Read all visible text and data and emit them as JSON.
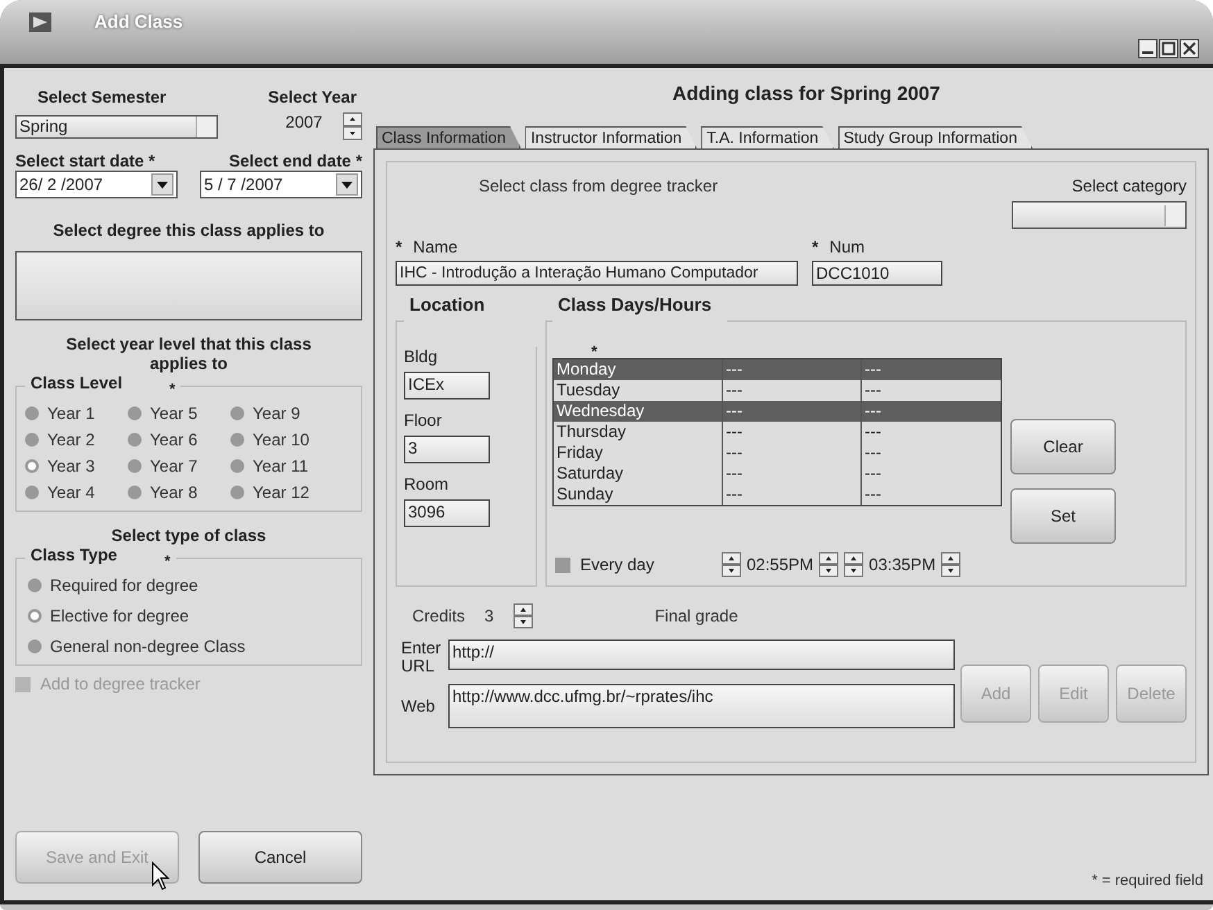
{
  "window": {
    "title": "Add Class"
  },
  "left": {
    "semester_label": "Select Semester",
    "year_label": "Select Year",
    "semester": "Spring",
    "year": "2007",
    "start_label": "Select start date *",
    "end_label": "Select end date *",
    "start_date": "26/ 2 /2007",
    "end_date": "5 / 7 /2007",
    "degree_label": "Select degree this class applies to",
    "year_level_label": "Select year level that this class applies to",
    "class_level": {
      "legend": "Class Level",
      "mark": "*",
      "options": [
        {
          "label": "Year 1",
          "selected": false
        },
        {
          "label": "Year 5",
          "selected": false
        },
        {
          "label": "Year 9",
          "selected": false
        },
        {
          "label": "Year 2",
          "selected": false
        },
        {
          "label": "Year 6",
          "selected": false
        },
        {
          "label": "Year 10",
          "selected": false
        },
        {
          "label": "Year 3",
          "selected": true
        },
        {
          "label": "Year 7",
          "selected": false
        },
        {
          "label": "Year 11",
          "selected": false
        },
        {
          "label": "Year 4",
          "selected": false
        },
        {
          "label": "Year 8",
          "selected": false
        },
        {
          "label": "Year 12",
          "selected": false
        }
      ]
    },
    "type_label": "Select type of class",
    "class_type": {
      "legend": "Class Type",
      "mark": "*",
      "options": [
        {
          "label": "Required for degree",
          "selected": false
        },
        {
          "label": "Elective for degree",
          "selected": true
        },
        {
          "label": "General non-degree Class",
          "selected": false
        }
      ]
    },
    "add_to_tracker": {
      "label": "Add to degree tracker",
      "checked": false,
      "disabled": true
    }
  },
  "heading": "Adding class for Spring 2007",
  "tabs": [
    {
      "label": "Class Information",
      "selected": true
    },
    {
      "label": "Instructor Information",
      "selected": false
    },
    {
      "label": "T.A. Information",
      "selected": false
    },
    {
      "label": "Study Group Information",
      "selected": false
    }
  ],
  "class_info": {
    "tracker_label": "Select class from degree tracker",
    "category_label": "Select category",
    "name_mark": "*",
    "name_label": "Name",
    "name": "IHC - Introdução a Interação Humano Computador",
    "num_mark": "*",
    "num_label": "Num",
    "num": "DCC1010",
    "location": {
      "legend": "Location",
      "bldg_label": "Bldg",
      "bldg": "ICEx",
      "floor_label": "Floor",
      "floor": "3",
      "room_label": "Room",
      "room": "3096"
    },
    "days": {
      "legend": "Class Days/Hours",
      "mark": "*",
      "rows": [
        {
          "day": "Monday",
          "start": "---",
          "end": "---",
          "selected": true
        },
        {
          "day": "Tuesday",
          "start": "---",
          "end": "---",
          "selected": false
        },
        {
          "day": "Wednesday",
          "start": "---",
          "end": "---",
          "selected": true
        },
        {
          "day": "Thursday",
          "start": "---",
          "end": "---",
          "selected": false
        },
        {
          "day": "Friday",
          "start": "---",
          "end": "---",
          "selected": false
        },
        {
          "day": "Saturday",
          "start": "---",
          "end": "---",
          "selected": false
        },
        {
          "day": "Sunday",
          "start": "---",
          "end": "---",
          "selected": false
        }
      ],
      "every_day": {
        "label": "Every day",
        "checked": false
      },
      "start_time": "02:55PM",
      "end_time": "03:35PM",
      "buttons": [
        "Clear",
        "Set"
      ]
    },
    "credits_label": "Credits",
    "credits": "3",
    "final_grade_label": "Final grade",
    "url_label": "Enter URL",
    "url": "http://",
    "web_label": "Web",
    "web": "http://www.dcc.ufmg.br/~rprates/ihc",
    "web_buttons": [
      {
        "label": "Add",
        "disabled": true
      },
      {
        "label": "Edit",
        "disabled": true
      },
      {
        "label": "Delete",
        "disabled": true
      }
    ]
  },
  "buttons": [
    {
      "label": "Save and Exit",
      "disabled": true
    },
    {
      "label": "Cancel",
      "disabled": false
    }
  ],
  "footnote": "* = required field"
}
